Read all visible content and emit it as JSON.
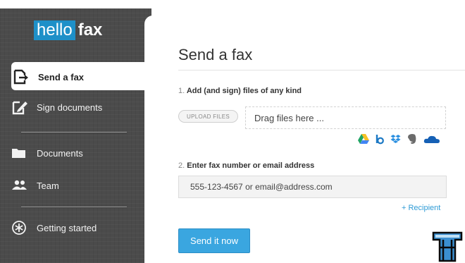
{
  "brand": {
    "hello": "hello",
    "fax": "fax",
    "accent_color": "#1e90c8"
  },
  "sidebar": {
    "items": [
      {
        "label": "Send a fax",
        "icon": "send-fax-icon",
        "active": true
      },
      {
        "label": "Sign documents",
        "icon": "sign-pen-icon"
      },
      {
        "label": "Documents",
        "icon": "folder-icon"
      },
      {
        "label": "Team",
        "icon": "team-icon"
      },
      {
        "label": "Getting started",
        "icon": "asterisk-circle-icon"
      }
    ]
  },
  "main": {
    "title": "Send a fax",
    "step1": {
      "number": "1.",
      "label": "Add (and sign) files of any kind"
    },
    "upload_label": "UPLOAD FILES",
    "drop_placeholder": "Drag files here ...",
    "cloud_services": [
      "google-drive-icon",
      "box-icon",
      "dropbox-icon",
      "evernote-icon",
      "onedrive-icon"
    ],
    "step2": {
      "number": "2.",
      "label": "Enter fax number or email address"
    },
    "fax_placeholder": "555-123-4567 or email@address.com",
    "add_recipient": "+ Recipient",
    "send_button": "Send it now"
  },
  "colors": {
    "sidebar_bg": "#4b4b4b",
    "button_blue": "#3aa6e0",
    "link_blue": "#2e9bd6"
  }
}
